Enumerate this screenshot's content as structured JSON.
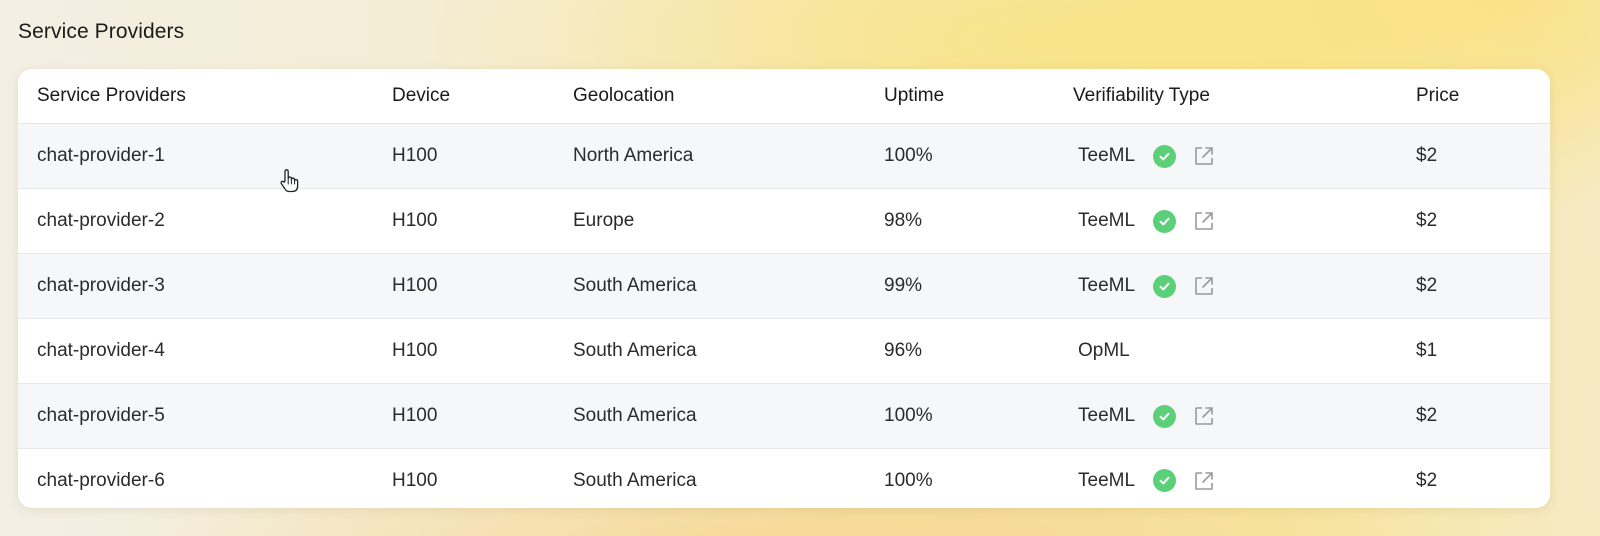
{
  "section_title": "Service Providers",
  "table": {
    "columns": [
      "Service Providers",
      "Device",
      "Geolocation",
      "Uptime",
      "Verifiability Type",
      "Price"
    ],
    "rows": [
      {
        "provider": "chat-provider-1",
        "device": "H100",
        "geolocation": "North America",
        "uptime": "100%",
        "verifiability": "TeeML",
        "verified": true,
        "price": "$2"
      },
      {
        "provider": "chat-provider-2",
        "device": "H100",
        "geolocation": "Europe",
        "uptime": "98%",
        "verifiability": "TeeML",
        "verified": true,
        "price": "$2"
      },
      {
        "provider": "chat-provider-3",
        "device": "H100",
        "geolocation": "South America",
        "uptime": "99%",
        "verifiability": "TeeML",
        "verified": true,
        "price": "$2"
      },
      {
        "provider": "chat-provider-4",
        "device": "H100",
        "geolocation": "South America",
        "uptime": "96%",
        "verifiability": "OpML",
        "verified": false,
        "price": "$1"
      },
      {
        "provider": "chat-provider-5",
        "device": "H100",
        "geolocation": "South America",
        "uptime": "100%",
        "verifiability": "TeeML",
        "verified": true,
        "price": "$2"
      },
      {
        "provider": "chat-provider-6",
        "device": "H100",
        "geolocation": "South America",
        "uptime": "100%",
        "verifiability": "TeeML",
        "verified": true,
        "price": "$2"
      }
    ]
  },
  "icons": {
    "verified": "check-circle-icon",
    "link": "external-link-icon",
    "cursor": "hand-pointer-cursor-icon"
  },
  "colors": {
    "verified_green": "#5ccf79",
    "shaded_row": "#f6f7f9",
    "card_background": "#ffffff"
  }
}
